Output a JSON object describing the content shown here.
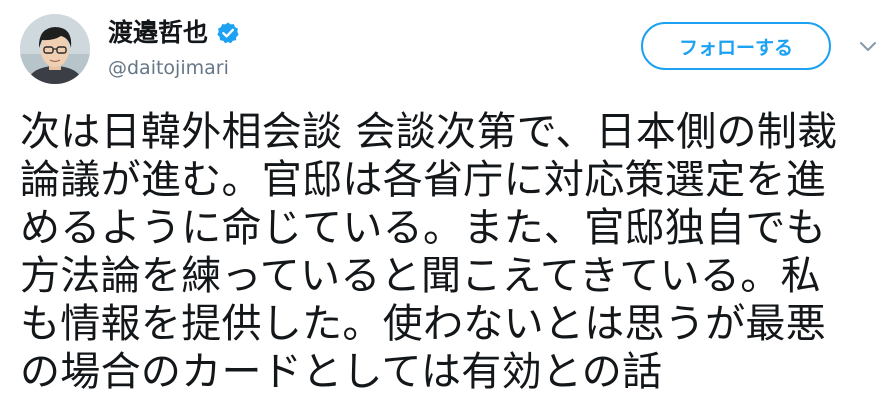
{
  "user": {
    "display_name": "渡邉哲也",
    "handle": "@daitojimari",
    "verified": true
  },
  "actions": {
    "follow_label": "フォローする"
  },
  "tweet": {
    "lines": [
      "次は日韓外相会談 会談次第で、日本側の制裁",
      "論議が進む。官邸は各省庁に対応策選定を進",
      "めるように命じている。また、官邸独自でも",
      "方法論を練っていると聞こえてきている。私",
      "も情報を提供した。使わないとは思うが最悪",
      "の場合のカードとしては有効との話"
    ]
  },
  "colors": {
    "accent": "#1da1f2",
    "text": "#14171a",
    "secondary_text": "#657786"
  },
  "icons": {
    "verified": "verified-badge-icon",
    "menu": "chevron-down-icon"
  }
}
